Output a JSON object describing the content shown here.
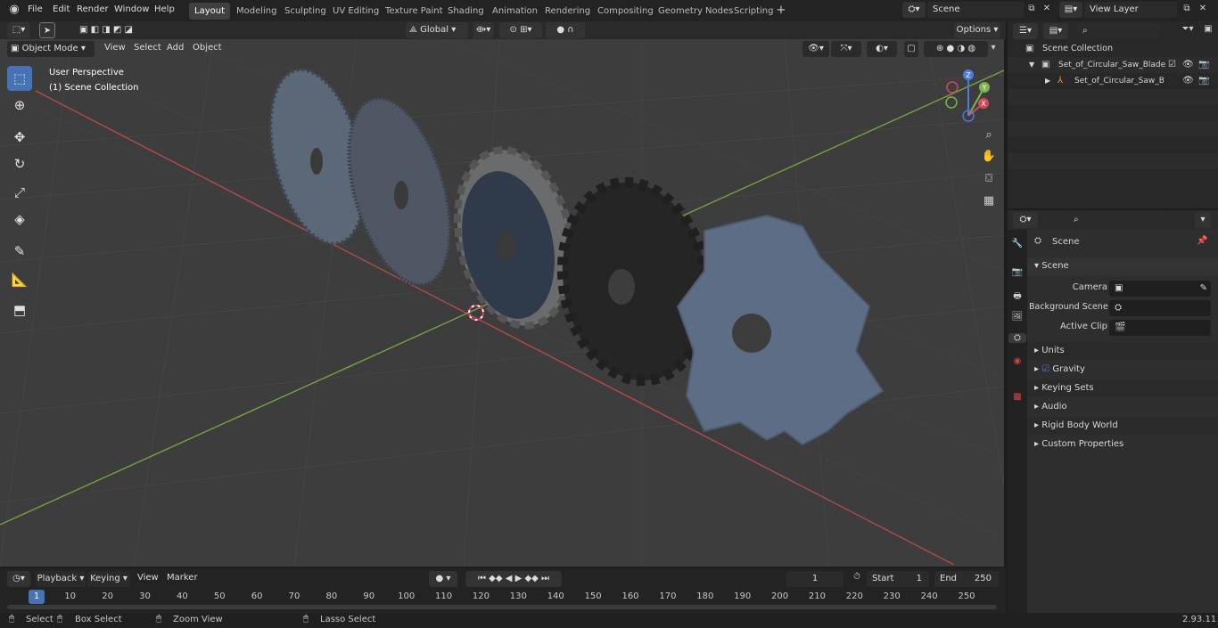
{
  "menus": [
    "File",
    "Edit",
    "Render",
    "Window",
    "Help"
  ],
  "workspaces": [
    "Layout",
    "Modeling",
    "Sculpting",
    "UV Editing",
    "Texture Paint",
    "Shading",
    "Animation",
    "Rendering",
    "Compositing",
    "Geometry Nodes",
    "Scripting"
  ],
  "scene_name": "Scene",
  "view_layer": "View Layer",
  "header": {
    "mode": "Object Mode",
    "view": "View",
    "select": "Select",
    "add": "Add",
    "object": "Object",
    "transform": "Global",
    "options": "Options"
  },
  "viewport": {
    "perspective": "User Perspective",
    "collection": "(1) Scene Collection",
    "gizmo": {
      "z": "Z",
      "y": "Y",
      "x": "X"
    }
  },
  "outliner": {
    "root": "Scene Collection",
    "items": [
      "Set_of_Circular_Saw_Blades_(",
      "Set_of_Circular_Saw_Blac"
    ]
  },
  "properties": {
    "context": "Scene",
    "panel": "Scene",
    "camera_label": "Camera",
    "bg_label": "Background Scene",
    "clip_label": "Active Clip",
    "sections": [
      "Units",
      "Gravity",
      "Keying Sets",
      "Audio",
      "Rigid Body World",
      "Custom Properties"
    ]
  },
  "timeline": {
    "playback": "Playback",
    "keying": "Keying",
    "view": "View",
    "marker": "Marker",
    "current": "1",
    "start_label": "Start",
    "start": "1",
    "end_label": "End",
    "end": "250",
    "ticks": [
      "1",
      "10",
      "20",
      "30",
      "40",
      "50",
      "60",
      "70",
      "80",
      "90",
      "100",
      "110",
      "120",
      "130",
      "140",
      "150",
      "160",
      "170",
      "180",
      "190",
      "200",
      "210",
      "220",
      "230",
      "240",
      "250"
    ]
  },
  "status": {
    "select": "Select",
    "box": "Box Select",
    "zoom": "Zoom View",
    "lasso": "Lasso Select",
    "version": "2.93.11"
  }
}
